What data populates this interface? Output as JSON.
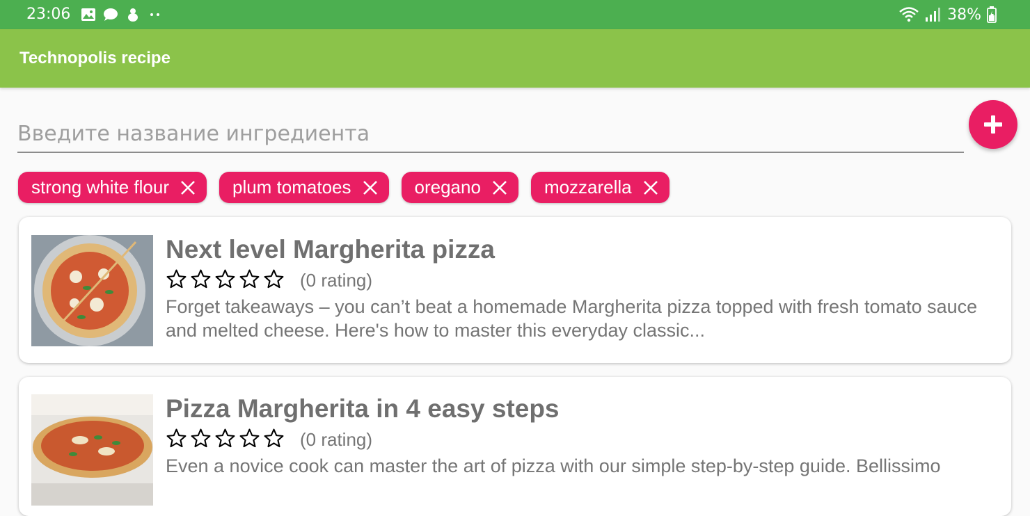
{
  "status_bar": {
    "time": "23:06",
    "battery": "38%",
    "left_icons": [
      "image-icon",
      "chat-icon",
      "bug-icon",
      "more-dots-icon"
    ],
    "right_icons": [
      "wifi-icon",
      "signal-icon",
      "battery-icon"
    ],
    "color": "#4caf50"
  },
  "app_bar": {
    "title": "Technopolis recipe",
    "color": "#8bc34a"
  },
  "search": {
    "placeholder": "Введите название ингредиента",
    "value": ""
  },
  "fab": {
    "icon": "plus-icon",
    "color": "#e91e63"
  },
  "ingredients": [
    {
      "label": "strong white flour"
    },
    {
      "label": "plum tomatoes"
    },
    {
      "label": "oregano"
    },
    {
      "label": "mozzarella"
    }
  ],
  "recipes": [
    {
      "title": "Next level Margherita pizza",
      "rating": 0,
      "rating_text": "(0 rating)",
      "description": "Forget takeaways – you can’t beat a homemade Margherita pizza topped with fresh tomato sauce and melted cheese. Here's how to master this everyday classic..."
    },
    {
      "title": "Pizza Margherita in 4 easy steps",
      "rating": 0,
      "rating_text": "(0 rating)",
      "description": "Even a novice cook can master the art of pizza with our simple step-by-step guide. Bellissimo"
    }
  ],
  "colors": {
    "accent": "#e91e63",
    "text_secondary": "#757575"
  }
}
